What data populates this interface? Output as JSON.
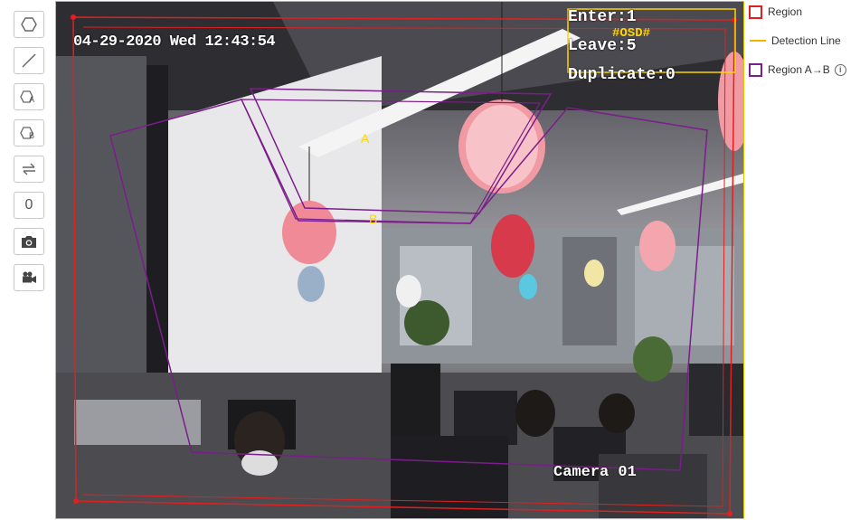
{
  "toolbar": {
    "tools": [
      {
        "name": "polygon-region-icon"
      },
      {
        "name": "detection-line-icon"
      },
      {
        "name": "region-a-icon",
        "letter": "A"
      },
      {
        "name": "region-b-icon",
        "letter": "B"
      },
      {
        "name": "swap-direction-icon"
      },
      {
        "name": "reset-count-icon",
        "label": "0"
      },
      {
        "name": "camera-snapshot-icon"
      },
      {
        "name": "video-record-icon"
      }
    ]
  },
  "video": {
    "osd_datetime": "04-29-2020 Wed 12:43:54",
    "osd_enter": "Enter:1",
    "osd_leave": "Leave:5",
    "osd_duplicate": "Duplicate:0",
    "osd_tag": "#OSD#",
    "camera_name": "Camera 01",
    "zone_a_label": "A",
    "zone_b_label": "B"
  },
  "legend": {
    "items": [
      {
        "label": "Region",
        "color": "#e02020",
        "kind": "box"
      },
      {
        "label": "Detection Line",
        "color": "#f5b400",
        "kind": "line"
      },
      {
        "label": "Region A→B",
        "color": "#7b1d8a",
        "kind": "box"
      }
    ],
    "info_icon": "info-icon"
  },
  "colors": {
    "region": "#e02020",
    "detection_line": "#f5b400",
    "region_ab": "#7b1d8a",
    "osd_tag": "#ffd400"
  }
}
